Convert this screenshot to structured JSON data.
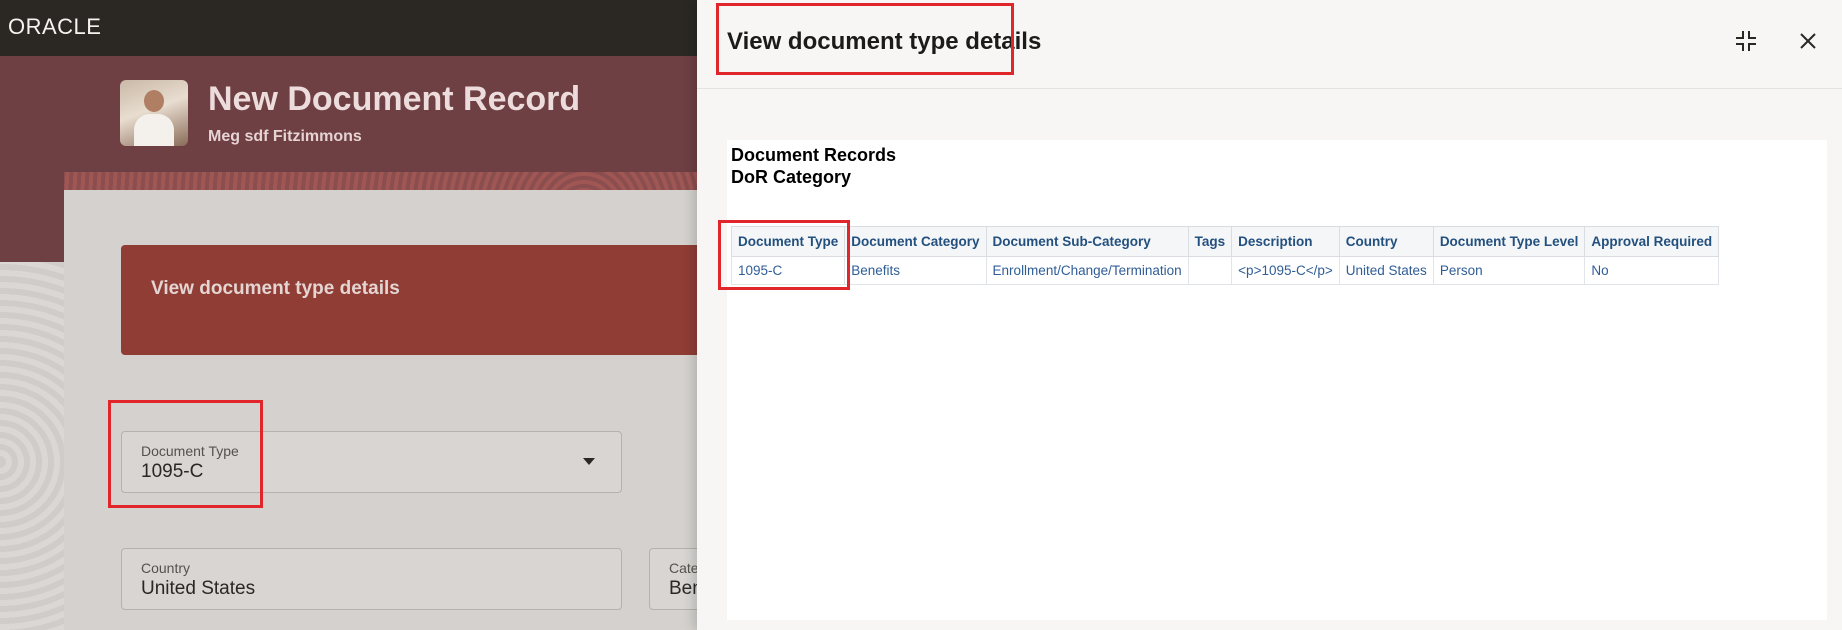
{
  "app": {
    "logo": "ORACLE"
  },
  "header": {
    "title": "New Document Record",
    "subtitle": "Meg sdf Fitzimmons"
  },
  "form": {
    "section_banner": "View document type details",
    "document_type": {
      "label": "Document Type",
      "value": "1095-C"
    },
    "country": {
      "label": "Country",
      "value": "United States"
    },
    "category": {
      "label": "Cate",
      "value": "Ben"
    }
  },
  "dialog": {
    "title": "View document type details",
    "report_title_line1": "Document Records",
    "report_title_line2": "DoR Category",
    "table": {
      "headers": [
        "Document Type",
        "Document Category",
        "Document Sub-Category",
        "Tags",
        "Description",
        "Country",
        "Document Type Level",
        "Approval Required"
      ],
      "rows": [
        [
          "1095-C",
          "Benefits",
          "Enrollment/Change/Termination",
          "",
          "<p>1095-C</p>",
          "United States",
          "Person",
          "No"
        ]
      ]
    },
    "icons": {
      "collapse": "collapse-icon",
      "close": "close-icon"
    }
  },
  "colors": {
    "highlight": "#e0262b",
    "topbar": "#2b2824",
    "hero": "#6e3f43",
    "section_banner": "#8f3d35",
    "link": "#2f5d96"
  }
}
